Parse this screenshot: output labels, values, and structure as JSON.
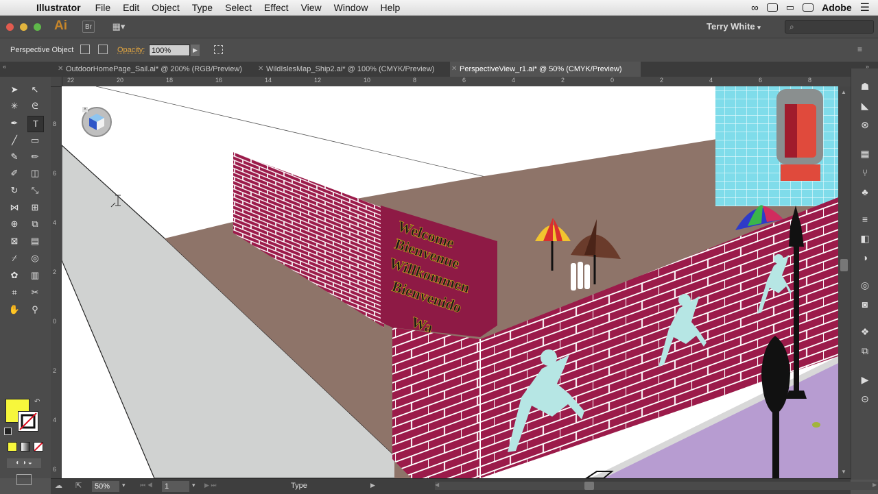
{
  "menubar": {
    "app_name": "Illustrator",
    "items": [
      "File",
      "Edit",
      "Object",
      "Type",
      "Select",
      "Effect",
      "View",
      "Window",
      "Help"
    ],
    "right_label": "Adobe"
  },
  "appbar": {
    "logo": "Ai",
    "bridge_label": "Br",
    "user_name": "Terry White",
    "search_glyph": "⌕"
  },
  "controlbar": {
    "selection_label": "Perspective Object",
    "opacity_label": "Opacity:",
    "opacity_value": "100%"
  },
  "tabs": [
    {
      "label": "OutdoorHomePage_Sail.ai* @ 200% (RGB/Preview)",
      "active": false
    },
    {
      "label": "WildIslesMap_Ship2.ai* @ 100% (CMYK/Preview)",
      "active": false
    },
    {
      "label": "PerspectiveView_r1.ai* @ 50% (CMYK/Preview)",
      "active": true
    }
  ],
  "ruler": {
    "h_ticks": [
      "22",
      "20",
      "18",
      "16",
      "14",
      "12",
      "10",
      "8",
      "6",
      "4",
      "2",
      "0",
      "2",
      "4",
      "6",
      "8"
    ],
    "v_ticks": [
      "8",
      "6",
      "4",
      "2",
      "0",
      "2",
      "4",
      "6"
    ]
  },
  "canvas": {
    "sign_lines": [
      "Welcome",
      "Bienvenue",
      "Willkommen",
      "Bienvenido",
      "Wa"
    ]
  },
  "statusbar": {
    "zoom": "50%",
    "artboard": "1",
    "current_tool": "Type"
  },
  "colors": {
    "fill": "#f7f73c",
    "stroke": "#ffffff",
    "brick": "#9b1b4a",
    "ground": "#8e7469",
    "sidewalk": "#d0d2d1",
    "purple_strip": "#b79cd1",
    "tile": "#7fdcea"
  }
}
